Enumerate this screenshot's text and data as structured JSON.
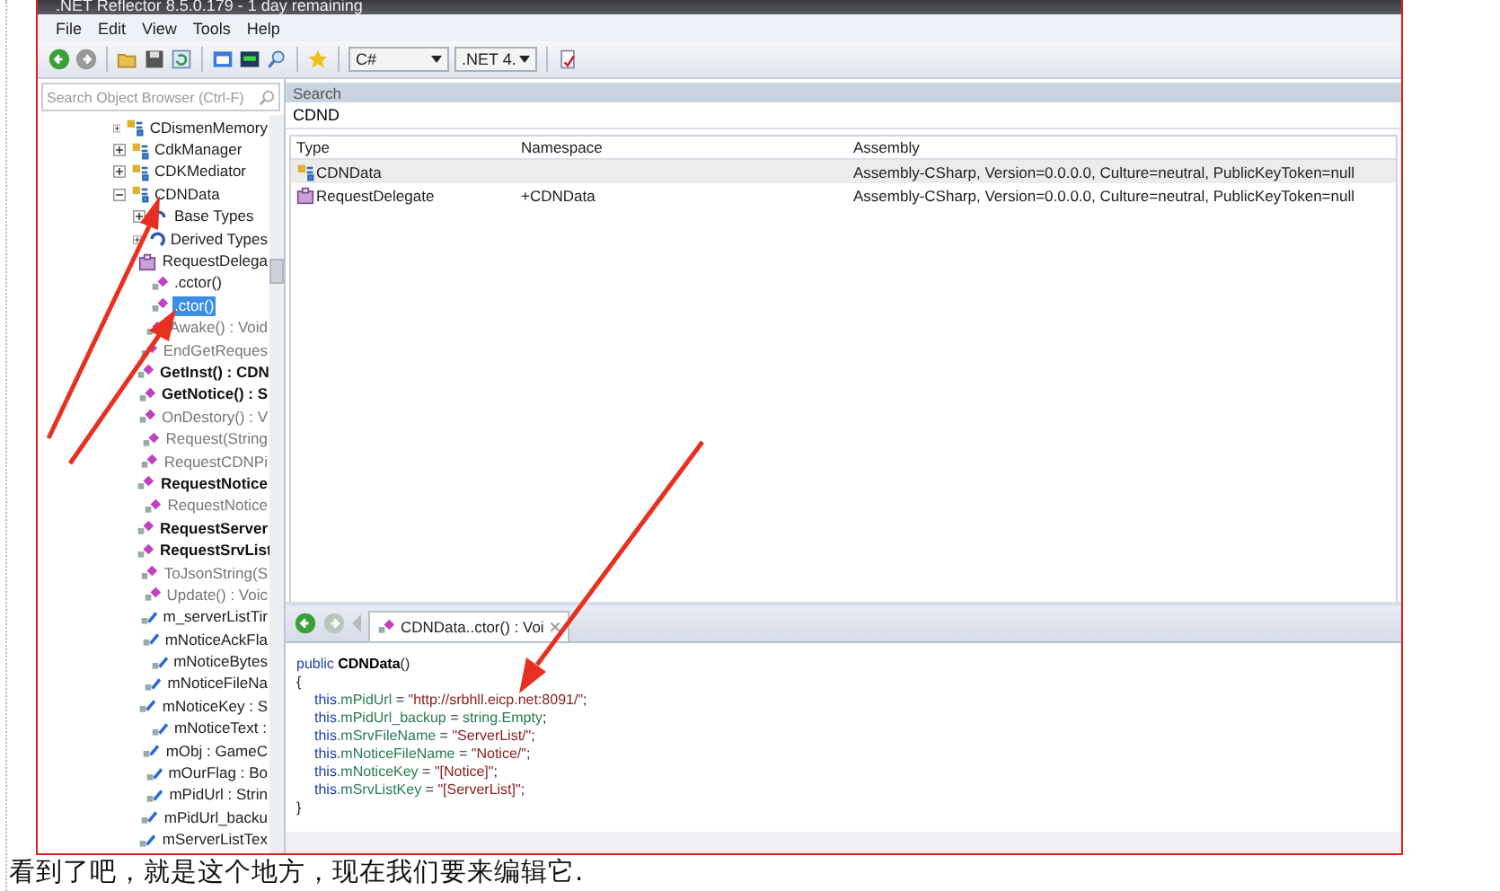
{
  "window": {
    "title": ".NET Reflector 8.5.0.179 - 1 day remaining"
  },
  "menu": [
    "File",
    "Edit",
    "View",
    "Tools",
    "Help"
  ],
  "toolbar": {
    "language": "C#",
    "framework": ".NET 4."
  },
  "object_browser": {
    "placeholder": "Search Object Browser (Ctrl-F)",
    "tree": [
      {
        "label": "CDismenMemory",
        "kind": "class",
        "expanded": false,
        "selected": false
      },
      {
        "label": "CdkManager",
        "kind": "class",
        "expanded": false,
        "selected": false
      },
      {
        "label": "CDKMediator",
        "kind": "class",
        "expanded": false,
        "selected": false
      },
      {
        "label": "CDNData",
        "kind": "class",
        "expanded": true,
        "selected": false,
        "children": [
          {
            "label": "Base Types",
            "kind": "base_types",
            "expanded": false,
            "selected": false
          },
          {
            "label": "Derived Types",
            "kind": "derived_types",
            "expanded": false,
            "selected": false
          },
          {
            "label": "RequestDelega",
            "kind": "nested",
            "expanded": false,
            "selected": false
          },
          {
            "label": ".cctor()",
            "kind": "method",
            "bold": false,
            "dimmed": false,
            "selected": false
          },
          {
            "label": ".ctor()",
            "kind": "method",
            "bold": false,
            "dimmed": false,
            "selected": true
          },
          {
            "label": "Awake() : Void",
            "kind": "method",
            "bold": false,
            "dimmed": true,
            "selected": false
          },
          {
            "label": "EndGetReques",
            "kind": "method",
            "bold": false,
            "dimmed": true,
            "selected": false
          },
          {
            "label": "GetInst() : CDN",
            "kind": "method",
            "bold": true,
            "dimmed": false,
            "selected": false
          },
          {
            "label": "GetNotice() : S",
            "kind": "method",
            "bold": true,
            "dimmed": false,
            "selected": false
          },
          {
            "label": "OnDestory() : V",
            "kind": "method",
            "bold": false,
            "dimmed": true,
            "selected": false
          },
          {
            "label": "Request(String",
            "kind": "method",
            "bold": false,
            "dimmed": true,
            "selected": false
          },
          {
            "label": "RequestCDNPi",
            "kind": "method",
            "bold": false,
            "dimmed": true,
            "selected": false
          },
          {
            "label": "RequestNotice",
            "kind": "method",
            "bold": true,
            "dimmed": false,
            "selected": false
          },
          {
            "label": "RequestNotice",
            "kind": "method",
            "bold": false,
            "dimmed": true,
            "selected": false
          },
          {
            "label": "RequestServer",
            "kind": "method",
            "bold": true,
            "dimmed": false,
            "selected": false
          },
          {
            "label": "RequestSrvList",
            "kind": "method",
            "bold": true,
            "dimmed": false,
            "selected": false
          },
          {
            "label": "ToJsonString(S",
            "kind": "method",
            "bold": false,
            "dimmed": true,
            "selected": false
          },
          {
            "label": "Update() : Voic",
            "kind": "method",
            "bold": false,
            "dimmed": true,
            "selected": false
          },
          {
            "label": "m_serverListTir",
            "kind": "field",
            "selected": false
          },
          {
            "label": "mNoticeAckFla",
            "kind": "field",
            "selected": false
          },
          {
            "label": "mNoticeBytes",
            "kind": "field",
            "selected": false
          },
          {
            "label": "mNoticeFileNa",
            "kind": "field",
            "selected": false
          },
          {
            "label": "mNoticeKey : S",
            "kind": "field",
            "selected": false
          },
          {
            "label": "mNoticeText :",
            "kind": "field",
            "selected": false
          },
          {
            "label": "mObj : GameC",
            "kind": "field",
            "selected": false
          },
          {
            "label": "mOurFlag : Bo",
            "kind": "field",
            "selected": false
          },
          {
            "label": "mPidUrl : Strin",
            "kind": "field",
            "selected": false
          },
          {
            "label": "mPidUrl_backu",
            "kind": "field",
            "selected": false
          },
          {
            "label": "mServerListTex",
            "kind": "field",
            "selected": false
          }
        ]
      }
    ]
  },
  "search": {
    "title": "Search",
    "query": "CDND",
    "columns": [
      "Type",
      "Namespace",
      "Assembly"
    ],
    "rows": [
      {
        "kind": "class",
        "type": "CDNData",
        "assembly": "Assembly-CSharp, Version=0.0.0.0, Culture=neutral, PublicKeyToken=null",
        "selected": true
      },
      {
        "kind": "nested",
        "type": "RequestDelegate",
        "namespace": "+CDNData",
        "assembly": "Assembly-CSharp, Version=0.0.0.0, Culture=neutral, PublicKeyToken=null",
        "selected": false
      }
    ]
  },
  "document": {
    "tab": "CDNData..ctor() : Voi",
    "code": {
      "header": [
        {
          "kind": "keyword",
          "text": "public "
        },
        {
          "kind": "name",
          "text": "CDNData"
        },
        {
          "kind": "plain",
          "text": "()"
        }
      ],
      "open": "{",
      "body": [
        [
          {
            "kind": "keyword",
            "text": "this"
          },
          {
            "kind": "member",
            "text": ".mPidUrl"
          },
          {
            "kind": "plain",
            "text": " = "
          },
          {
            "kind": "string",
            "text": "\"http://srbhll.eicp.net:8091/\""
          },
          {
            "kind": "plain",
            "text": ";"
          }
        ],
        [
          {
            "kind": "keyword",
            "text": "this"
          },
          {
            "kind": "member",
            "text": ".mPidUrl_backup"
          },
          {
            "kind": "plain",
            "text": " = "
          },
          {
            "kind": "member",
            "text": "string.Empty"
          },
          {
            "kind": "plain",
            "text": ";"
          }
        ],
        [
          {
            "kind": "keyword",
            "text": "this"
          },
          {
            "kind": "member",
            "text": ".mSrvFileName"
          },
          {
            "kind": "plain",
            "text": " = "
          },
          {
            "kind": "string",
            "text": "\"ServerList/\""
          },
          {
            "kind": "plain",
            "text": ";"
          }
        ],
        [
          {
            "kind": "keyword",
            "text": "this"
          },
          {
            "kind": "member",
            "text": ".mNoticeFileName"
          },
          {
            "kind": "plain",
            "text": " = "
          },
          {
            "kind": "string",
            "text": "\"Notice/\""
          },
          {
            "kind": "plain",
            "text": ";"
          }
        ],
        [
          {
            "kind": "keyword",
            "text": "this"
          },
          {
            "kind": "member",
            "text": ".mNoticeKey"
          },
          {
            "kind": "plain",
            "text": " = "
          },
          {
            "kind": "string",
            "text": "\"[Notice]\""
          },
          {
            "kind": "plain",
            "text": ";"
          }
        ],
        [
          {
            "kind": "keyword",
            "text": "this"
          },
          {
            "kind": "member",
            "text": ".mSrvListKey"
          },
          {
            "kind": "plain",
            "text": " = "
          },
          {
            "kind": "string",
            "text": "\"[ServerList]\""
          },
          {
            "kind": "plain",
            "text": ";"
          }
        ]
      ],
      "close": "}"
    }
  },
  "caption": "看到了吧，就是这个地方，现在我们要来编辑它."
}
